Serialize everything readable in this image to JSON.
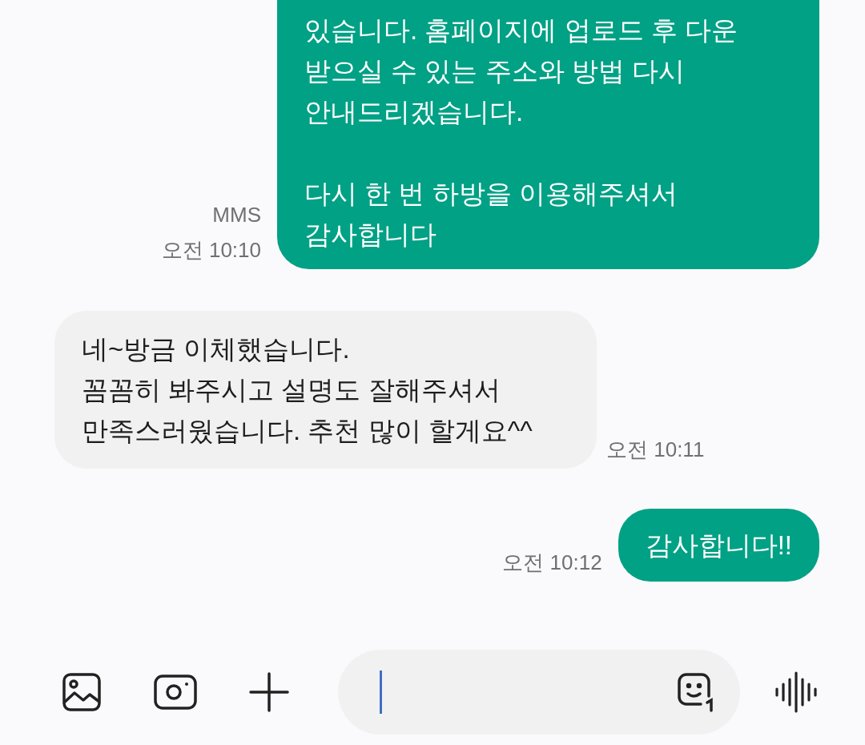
{
  "messages": [
    {
      "outgoing": true,
      "text": "있습니다. 홈페이지에 업로드 후 다운\n받으실 수 있는 주소와 방법 다시\n안내드리겠습니다.\n\n다시 한 번 하방을 이용해주셔서\n감사합니다",
      "meta": [
        "MMS",
        "오전 10:10"
      ],
      "cut_top": true
    },
    {
      "outgoing": false,
      "text": "네~방금 이체했습니다.\n꼼꼼히 봐주시고 설명도 잘해주셔서\n만족스러웠습니다. 추천 많이 할게요^^",
      "meta": [
        "오전 10:11"
      ],
      "cut_top": false
    },
    {
      "outgoing": true,
      "text": "감사합니다!!",
      "meta": [
        "오전 10:12"
      ],
      "cut_top": false
    }
  ]
}
